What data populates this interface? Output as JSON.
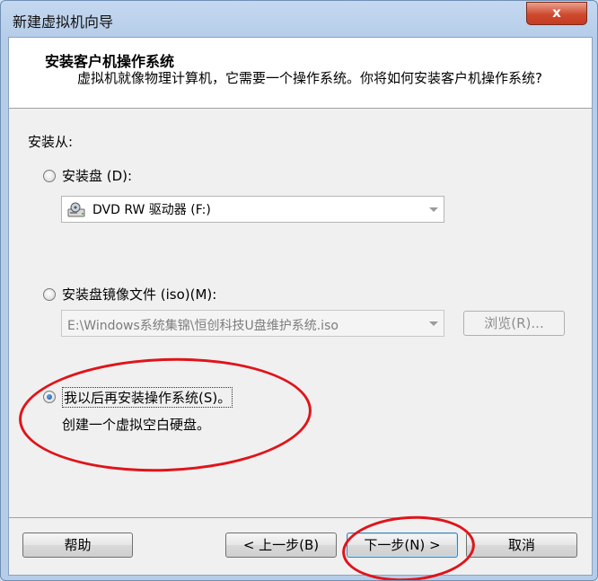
{
  "window": {
    "title": "新建虚拟机向导",
    "close_label": "x"
  },
  "header": {
    "title": "安装客户机操作系统",
    "description": "虚拟机就像物理计算机，它需要一个操作系统。你将如何安装客户机操作系统?"
  },
  "install_from_label": "安装从:",
  "options": {
    "disc": {
      "label": "安装盘 (D):",
      "selected": false,
      "drive_value": "DVD RW 驱动器 (F:)",
      "icon": "dvd-drive-icon"
    },
    "iso": {
      "label": "安装盘镜像文件 (iso)(M):",
      "selected": false,
      "path_value": "E:\\Windows系统集锦\\恒创科技U盘维护系统.iso",
      "browse_label": "浏览(R)..."
    },
    "later": {
      "label": "我以后再安装操作系统(S)。",
      "selected": true,
      "description": "创建一个虚拟空白硬盘。"
    }
  },
  "footer": {
    "help_label": "帮助",
    "back_label": "< 上一步(B)",
    "next_label": "下一步(N) >",
    "cancel_label": "取消"
  },
  "colors": {
    "annotation": "#e0141a",
    "accent": "#3c7fb1"
  }
}
